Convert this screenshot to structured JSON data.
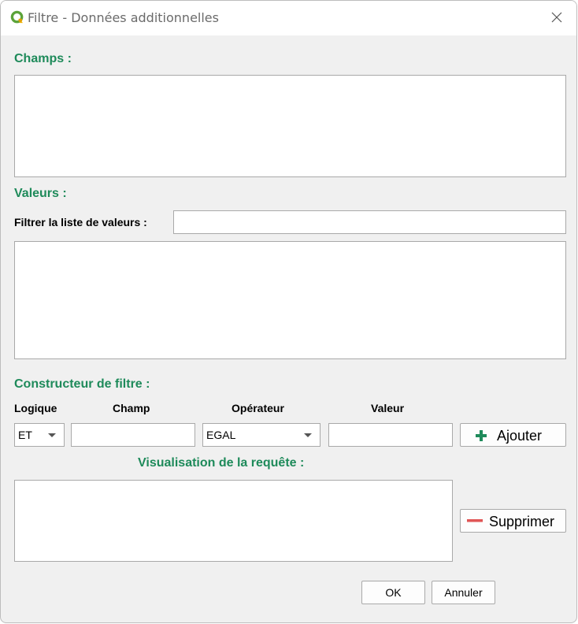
{
  "window": {
    "title": "Filtre - Données additionnelles"
  },
  "champs": {
    "label": "Champs :"
  },
  "valeurs": {
    "label": "Valeurs :",
    "filter_label": "Filtrer la liste de valeurs :",
    "filter_value": ""
  },
  "constructeur": {
    "label": "Constructeur de filtre :",
    "headers": {
      "logique": "Logique",
      "champ": "Champ",
      "operateur": "Opérateur",
      "valeur": "Valeur"
    },
    "logique_value": "ET",
    "champ_value": "",
    "operateur_value": "EGAL",
    "valeur_value": "",
    "add_label": "Ajouter"
  },
  "visualisation": {
    "label": "Visualisation de la requête :",
    "remove_label": "Supprimer"
  },
  "footer": {
    "ok_label": "OK",
    "cancel_label": "Annuler"
  },
  "colors": {
    "section": "#1e8a5a",
    "add_icon": "#1e8a5a",
    "remove_icon": "#e05555"
  },
  "icons": {
    "app": "qgis-logo-icon",
    "close": "close-icon",
    "add": "plus-icon",
    "remove": "minus-icon",
    "dropdown": "chevron-down-icon"
  }
}
